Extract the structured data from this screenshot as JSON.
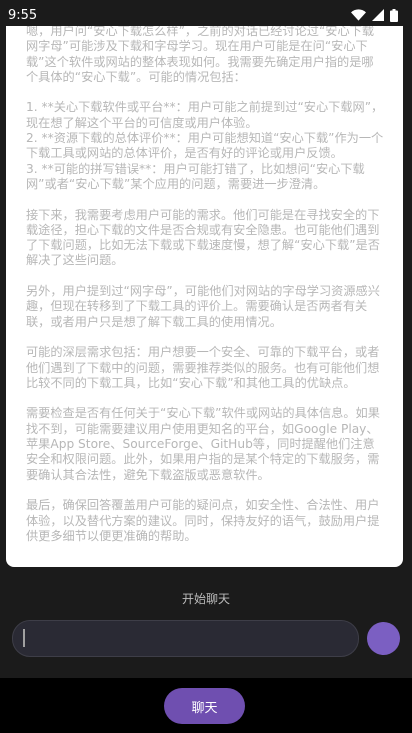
{
  "status_bar": {
    "time": "9:55",
    "icons": [
      "wifi-icon",
      "cellular-signal-icon",
      "battery-icon"
    ]
  },
  "card": {
    "text": "嗯，用户问“安心下载怎么样”，之前的对话已经讨论过“安心下载网字母”可能涉及下载和字母学习。现在用户可能是在问“安心下载”这个软件或网站的整体表现如何。我需要先确定用户指的是哪个具体的“安心下载”。可能的情况包括：\n\n1. **关心下载软件或平台**：用户可能之前提到过“安心下载网”，现在想了解这个平台的可信度或用户体验。\n2. **资源下载的总体评价**：用户可能想知道“安心下载”作为一个下载工具或网站的总体评价，是否有好的评论或用户反馈。\n3. **可能的拼写错误**：用户可能打错了，比如想问“安心下载网”或者“安心下载”某个应用的问题，需要进一步澄清。\n\n接下来，我需要考虑用户可能的需求。他们可能是在寻找安全的下载途径，担心下载的文件是否合规或有安全隐患。也可能他们遇到了下载问题，比如无法下载或下载速度慢，想了解“安心下载”是否解决了这些问题。\n\n另外，用户提到过“网字母”，可能他们对网站的字母学习资源感兴趣，但现在转移到了下载工具的评价上。需要确认是否两者有关联，或者用户只是想了解下载工具的使用情况。\n\n可能的深层需求包括：用户想要一个安全、可靠的下载平台，或者他们遇到了下载中的问题，需要推荐类似的服务。也有可能他们想比较不同的下载工具，比如“安心下载”和其他工具的优缺点。\n\n需要检查是否有任何关于“安心下载”软件或网站的具体信息。如果找不到，可能需要建议用户使用更知名的平台，如Google Play、苹果App Store、SourceForge、GitHub等，同时提醒他们注意安全和权限问题。此外，如果用户指的是某个特定的下载服务，需要确认其合法性，避免下载盗版或恶意软件。\n\n最后，确保回答覆盖用户可能的疑问点，如安全性、合法性、用户体验，以及替代方案的建议。同时，保持友好的语气，鼓励用户提供更多细节以便更准确的帮助。"
  },
  "chat": {
    "start_label": "开始聊天",
    "input_value": "",
    "chat_button_label": "聊天"
  },
  "colors": {
    "background": "#1b1b1b",
    "card": "#ffffff",
    "card_text": "#b7b7b7",
    "accent": "#7b5fc2",
    "button": "#6f4fb0"
  }
}
